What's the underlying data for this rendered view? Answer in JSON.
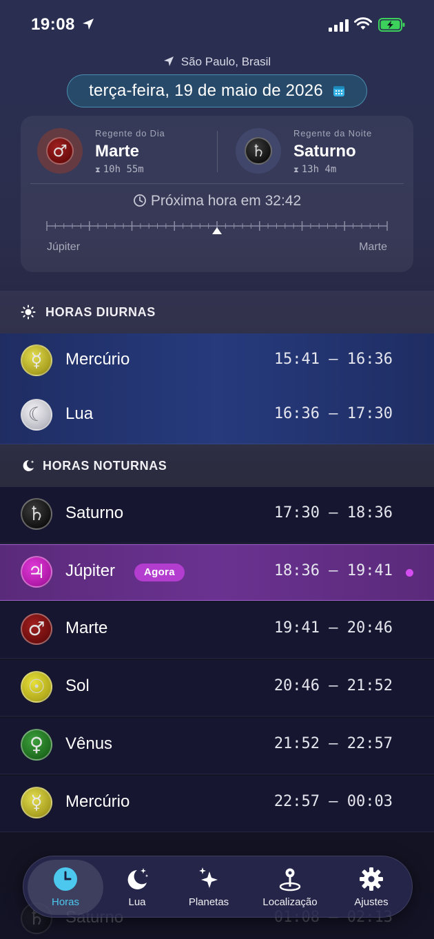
{
  "status_bar": {
    "time": "19:08"
  },
  "header": {
    "location": "São Paulo, Brasil",
    "date": "terça-feira, 19 de maio de 2026"
  },
  "rulers": {
    "day": {
      "label": "Regente do Dia",
      "planet": "Marte",
      "duration": "10h 55m",
      "symbol": "♂"
    },
    "night": {
      "label": "Regente da Noite",
      "planet": "Saturno",
      "duration": "13h 4m",
      "symbol": "♄"
    },
    "next_hour": "Próxima hora em 32:42",
    "timeline_left": "Júpiter",
    "timeline_right": "Marte",
    "timeline_progress": 0.5
  },
  "sections": {
    "day": "HORAS DIURNAS",
    "night": "HORAS NOTURNAS"
  },
  "day_hours": [
    {
      "planet": "Mercúrio",
      "symbol": "☿",
      "time": "15:41 – 16:36"
    },
    {
      "planet": "Lua",
      "symbol": "☾",
      "time": "16:36 – 17:30"
    }
  ],
  "night_hours": [
    {
      "planet": "Saturno",
      "symbol": "♄",
      "time": "17:30 – 18:36"
    },
    {
      "planet": "Júpiter",
      "symbol": "♃",
      "time": "18:36 – 19:41",
      "badge": "Agora"
    },
    {
      "planet": "Marte",
      "symbol": "♂",
      "time": "19:41 – 20:46"
    },
    {
      "planet": "Sol",
      "symbol": "☉",
      "time": "20:46 – 21:52"
    },
    {
      "planet": "Vênus",
      "symbol": "♀",
      "time": "21:52 – 22:57"
    },
    {
      "planet": "Mercúrio",
      "symbol": "☿",
      "time": "22:57 – 00:03"
    },
    {
      "planet": "Saturno",
      "symbol": "♄",
      "time": "01:08 – 02:13"
    }
  ],
  "tabs": [
    {
      "label": "Horas",
      "icon": "clock-icon"
    },
    {
      "label": "Lua",
      "icon": "moon-stars-icon"
    },
    {
      "label": "Planetas",
      "icon": "sparkles-icon"
    },
    {
      "label": "Localização",
      "icon": "map-pin-icon"
    },
    {
      "label": "Ajustes",
      "icon": "gear-icon"
    }
  ],
  "colors": {
    "accent": "#4cc7ee",
    "current_hour": "#b23dcf",
    "day_row": "#263a7c",
    "night_row": "#161630"
  }
}
